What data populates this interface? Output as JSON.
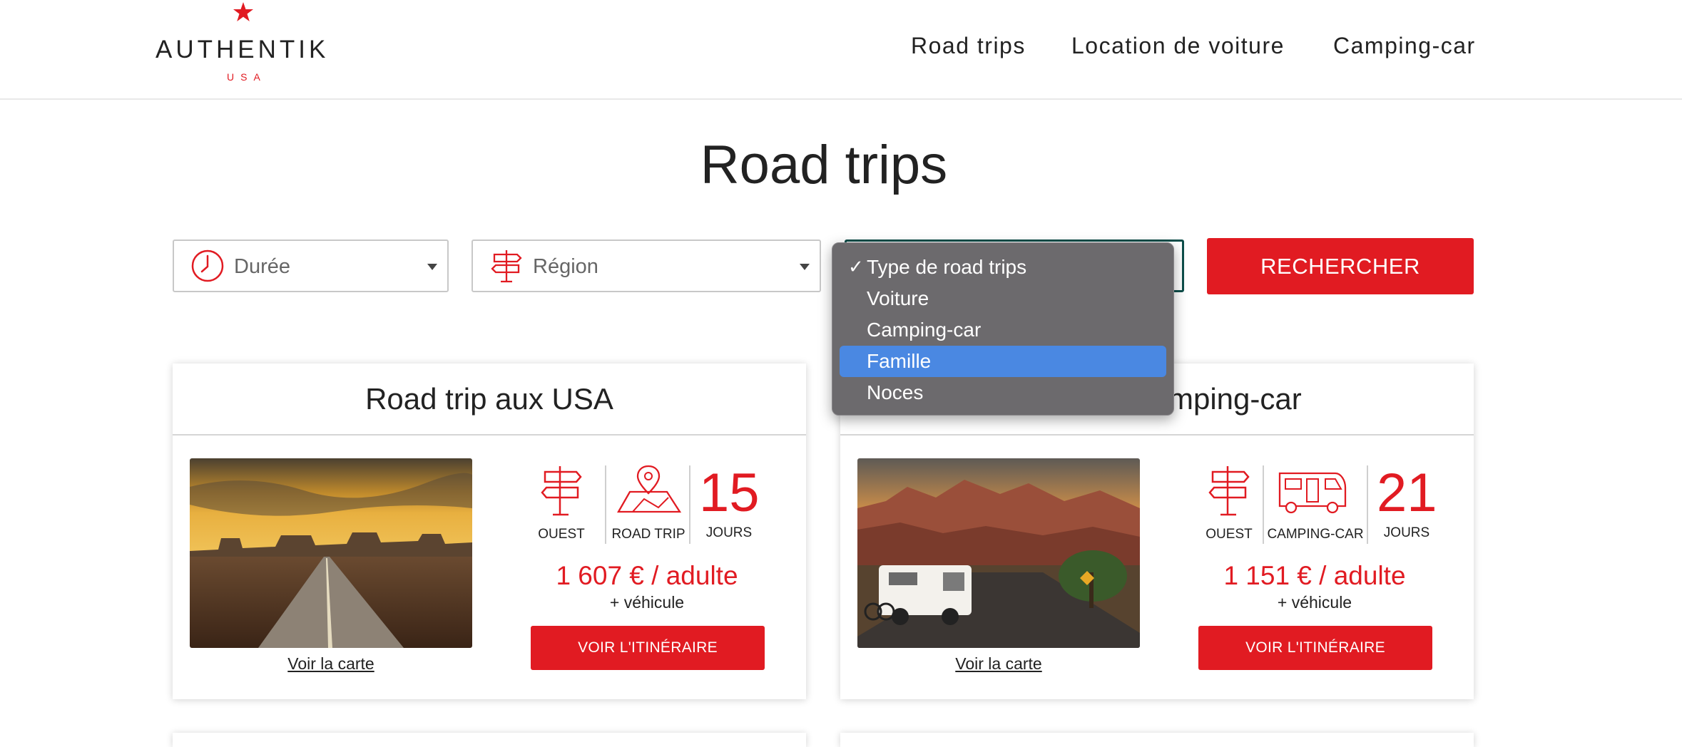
{
  "brand": {
    "name": "AUTHENTIK",
    "sub": "USA",
    "accent": "#e11b22",
    "icon": "red-star-icon"
  },
  "nav": {
    "items": [
      "Road trips",
      "Location de voiture",
      "Camping-car"
    ]
  },
  "page": {
    "title": "Road trips"
  },
  "filters": {
    "duration": {
      "placeholder": "Durée",
      "icon": "clock-icon"
    },
    "region": {
      "placeholder": "Région",
      "icon": "signpost-icon"
    },
    "type": {
      "options": [
        "Type de road trips",
        "Voiture",
        "Camping-car",
        "Famille",
        "Noces"
      ],
      "checked": "Type de road trips",
      "highlighted": "Famille"
    },
    "search_label": "RECHERCHER"
  },
  "cards": [
    {
      "title": "Road trip aux USA",
      "region": "OUEST",
      "type": "ROAD TRIP",
      "days": "15",
      "days_label": "JOURS",
      "price": "1 607 € / adulte",
      "vehicle": "+ véhicule",
      "cta": "VOIR L'ITINÉRAIRE",
      "map_link": "Voir la carte",
      "image": "desert-road-monument-valley"
    },
    {
      "title": "Road trip en camping-car",
      "title_visible": "mping-car",
      "region": "OUEST",
      "type": "CAMPING-CAR",
      "days": "21",
      "days_label": "JOURS",
      "price": "1 151 € / adulte",
      "vehicle": "+ véhicule",
      "cta": "VOIR L'ITINÉRAIRE",
      "map_link": "Voir la carte",
      "image": "rv-canyon-road"
    }
  ]
}
